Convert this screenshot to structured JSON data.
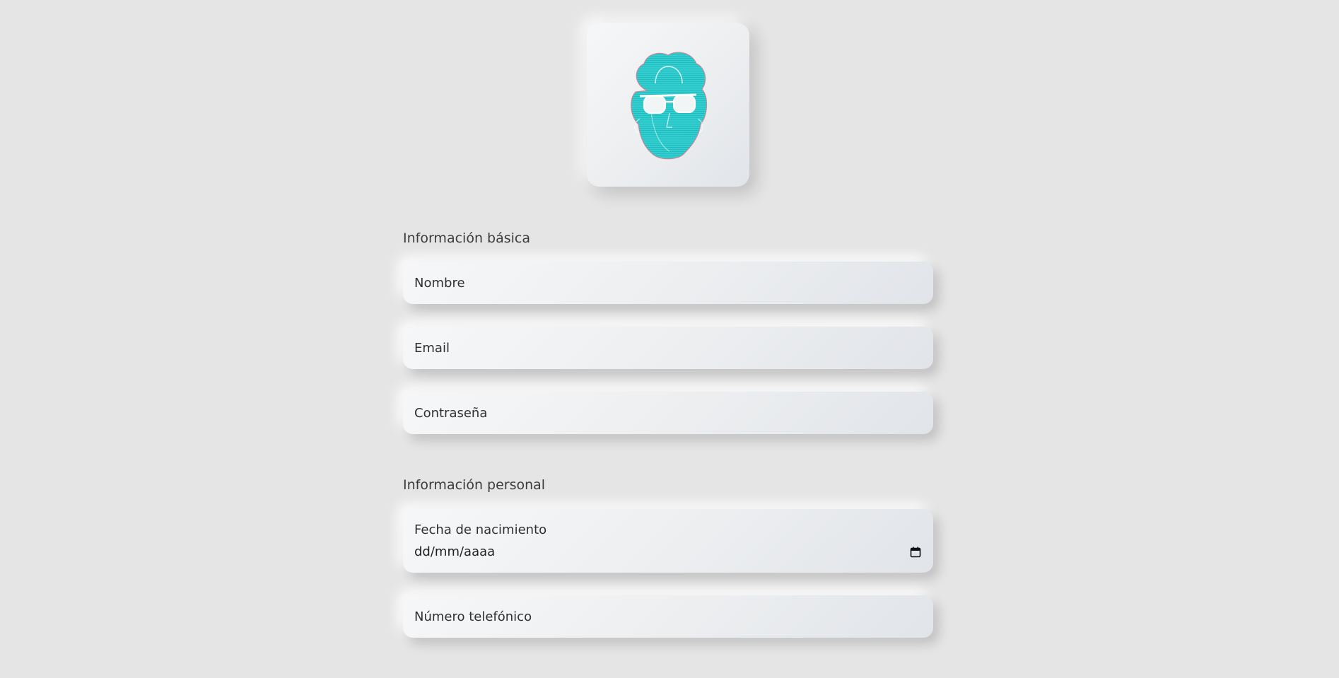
{
  "avatar": {
    "icon": "face-with-glasses-icon",
    "accent_color": "#2ecfcf"
  },
  "sections": {
    "basic": {
      "title": "Información básica",
      "fields": {
        "name": "Nombre",
        "email": "Email",
        "password": "Contraseña"
      }
    },
    "personal": {
      "title": "Información personal",
      "fields": {
        "birthdate_label": "Fecha de nacimiento",
        "birthdate_placeholder": "dd/mm/aaaa",
        "phone": "Número telefónico"
      }
    }
  }
}
